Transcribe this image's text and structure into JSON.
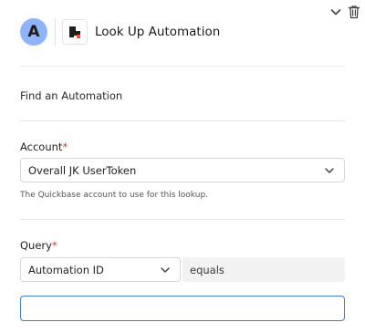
{
  "header": {
    "avatar_letter": "A",
    "title": "Look Up Automation"
  },
  "action": {
    "text": "Find an Automation"
  },
  "account": {
    "label": "Account",
    "required_marker": "*",
    "selected": "Overall JK UserToken",
    "help": "The Quickbase account to use for this lookup."
  },
  "query": {
    "label": "Query",
    "required_marker": "*",
    "field_selected": "Automation ID",
    "operator": "equals",
    "value": "",
    "value_placeholder": ""
  },
  "icons": {
    "collapse": "chevron-down-icon",
    "delete": "trash-icon",
    "app": "quickbase-logo-icon"
  },
  "colors": {
    "avatar_bg": "#8fb4f7",
    "required": "#d9352b",
    "focus_border": "#3c7fd0",
    "logo_dark": "#1f1f1f",
    "logo_accent": "#e85d2f"
  }
}
